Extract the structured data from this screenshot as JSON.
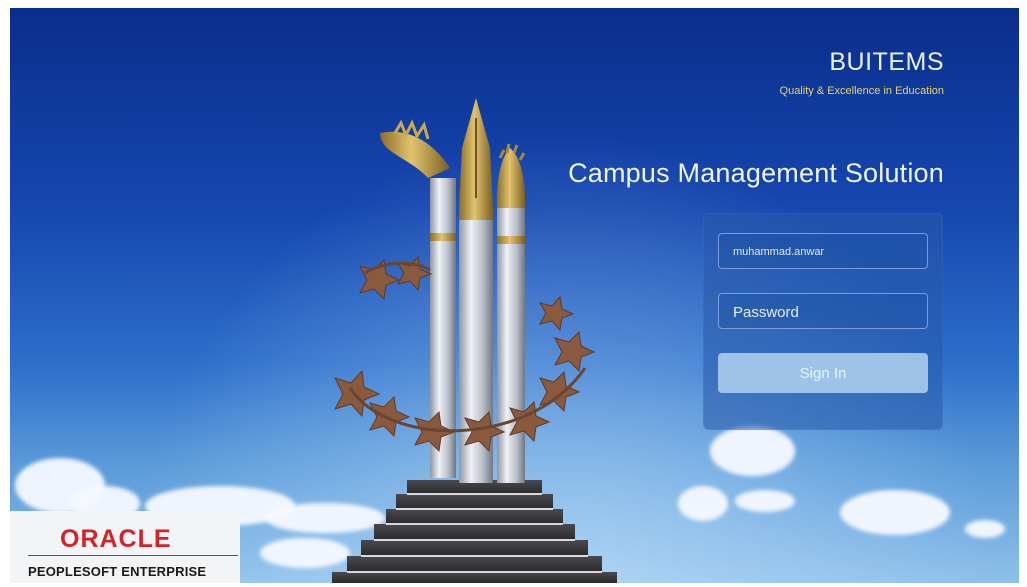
{
  "brand": {
    "name": "BUITEMS",
    "tagline": "Quality & Excellence in Education"
  },
  "app": {
    "title": "Campus Management Solution"
  },
  "login": {
    "username_value": "muhammad.anwar",
    "password_placeholder": "Password",
    "signin_label": "Sign In"
  },
  "footer": {
    "vendor_logo": "ORACLE",
    "product": "PEOPLESOFT ENTERPRISE"
  },
  "colors": {
    "sky_top": "#0a2e8c",
    "tagline": "#e7d36a",
    "signin_button": "#9fc3e8",
    "oracle_red": "#d2232a"
  }
}
